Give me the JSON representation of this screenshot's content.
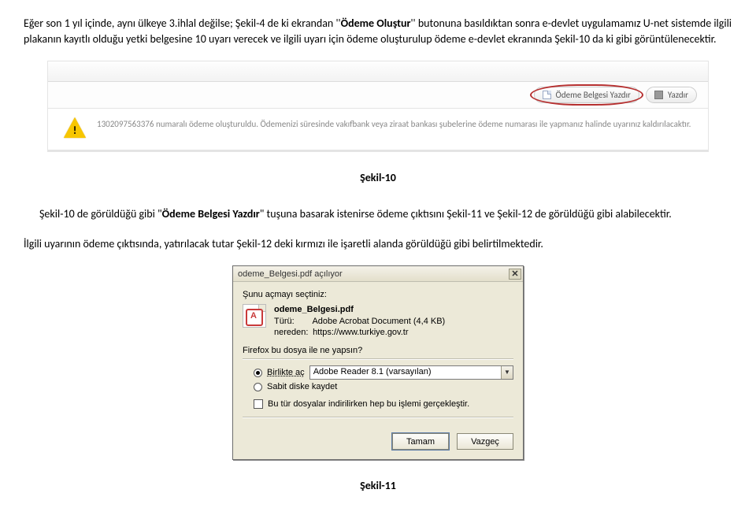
{
  "paragraph1_prefix": "Eğer son 1 yıl içinde, aynı ülkeye 3.ihlal değilse; Şekil-4 de ki ekrandan ''",
  "paragraph1_bold": "Ödeme Oluştur",
  "paragraph1_suffix": "'' butonuna basıldıktan sonra e-devlet uygulamamız U-net sistemde ilgili plakanın kayıtlı olduğu yetki belgesine 10 uyarı verecek ve ilgili uyarı için ödeme oluşturulup ödeme e-devlet ekranında Şekil-10 da ki gibi görüntülenecektir.",
  "btn_yazdir_belge": "Ödeme Belgesi Yazdır",
  "btn_yazdir": "Yazdır",
  "warn_text": "1302097563376 numaralı ödeme oluşturuldu. Ödemenizi süresinde vakıfbank veya ziraat bankası şubelerine ödeme numarası ile yapmanız halinde uyarınız kaldırılacaktır.",
  "caption_s10": "Şekil-10",
  "paragraph2_prefix": "Şekil-10 de görüldüğü gibi \"",
  "paragraph2_bold": "Ödeme Belgesi Yazdır",
  "paragraph2_suffix": "\" tuşuna basarak istenirse ödeme çıktısını Şekil-11 ve Şekil-12 de görüldüğü gibi alabilecektir.",
  "paragraph3": "İlgili uyarının ödeme çıktısında, yatırılacak tutar Şekil-12 deki kırmızı ile işaretli alanda görüldüğü gibi belirtilmektedir.",
  "dlg_title": "odeme_Belgesi.pdf açılıyor",
  "dlg_prompt": "Şunu açmayı seçtiniz:",
  "dlg_filename": "odeme_Belgesi.pdf",
  "dlg_type_k": "Türü:",
  "dlg_type_v": "Adobe Acrobat Document (4,4 KB)",
  "dlg_from_k": "nereden:",
  "dlg_from_v": "https://www.turkiye.gov.tr",
  "dlg_q": "Firefox bu dosya ile ne yapsın?",
  "dlg_open": "Birlikte aç",
  "dlg_open_app": "Adobe Reader 8.1 (varsayılan)",
  "dlg_save": "Sabit diske kaydet",
  "dlg_remember": "Bu tür dosyalar indirilirken hep bu işlemi gerçekleştir.",
  "dlg_ok": "Tamam",
  "dlg_cancel": "Vazgeç",
  "caption_s11": "Şekil-11"
}
